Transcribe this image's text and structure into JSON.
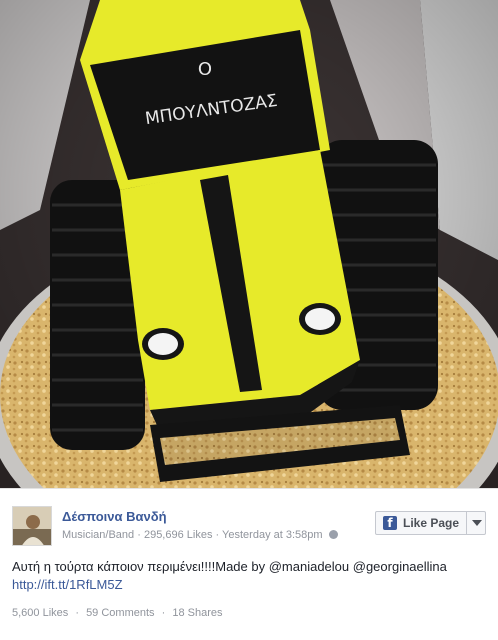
{
  "post": {
    "page_name": "Δέσποινα Βανδή",
    "category": "Musician/Band",
    "likes_count": "295,696 Likes",
    "meta_sep": "·",
    "time": "Yesterday at 3:58pm",
    "time_sep": "·",
    "text": "Αυτή η τούρτα κάποιον περιμένει!!!!Made by @maniadelou @georginaellina",
    "link": "http://ift.tt/1RfLM5Z"
  },
  "like_button": {
    "label": "Like Page",
    "icon": "facebook-f-icon",
    "dropdown_icon": "caret-down-icon"
  },
  "stats": {
    "likes": "5,600 Likes",
    "comments": "59 Comments",
    "shares": "18 Shares",
    "sep": "·"
  },
  "photo": {
    "cake_lettering_line1": "Ο",
    "cake_lettering_line2": "ΜΠΟΥΛΝΤΟΖΑΣ"
  },
  "colors": {
    "link_blue": "#3b5998",
    "cake_yellow": "#e7ea2a",
    "fondant_black": "#151515",
    "crumbs": "#d9b56c"
  }
}
